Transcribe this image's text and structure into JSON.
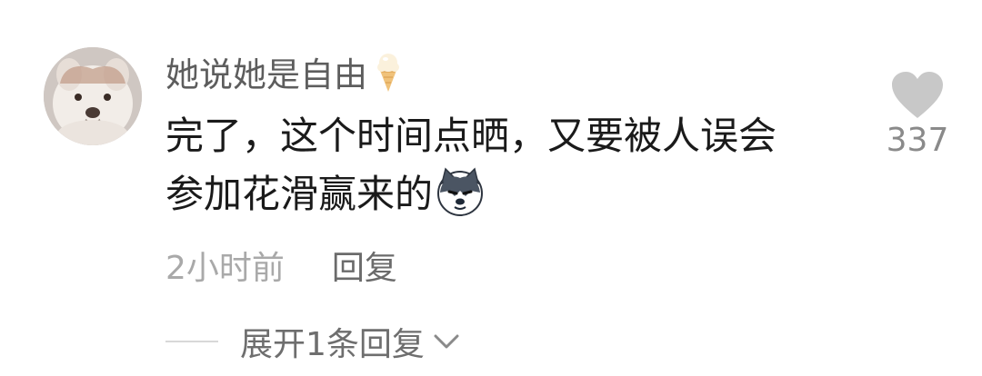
{
  "comment": {
    "username": "她说她是自由",
    "username_badge_icon": "ice-cream-icon",
    "text_line1": "完了，这个时间点晒，又要被人误会",
    "text_line2": "参加花滑赢来的",
    "inline_emoji_icon": "husky-dog-emoji-icon",
    "timestamp": "2小时前",
    "reply_label": "回复",
    "expand_replies_label": "展开1条回复",
    "like_count": "337",
    "like_icon": "heart-icon"
  },
  "colors": {
    "username": "#5d5d5d",
    "text": "#1a1a1a",
    "meta_gray": "#a9a9a9",
    "reply_gray": "#6b6b6b",
    "heart_gray": "#c8c8c8"
  }
}
